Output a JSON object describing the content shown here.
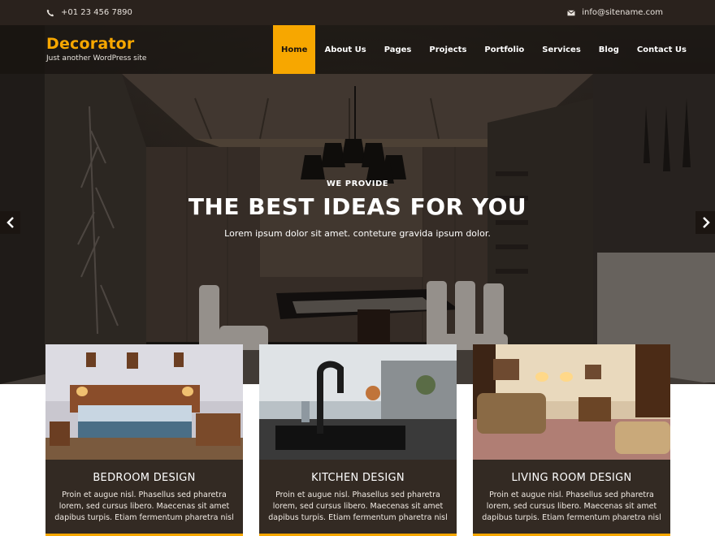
{
  "topbar": {
    "phone": "+01 23 456 7890",
    "email": "info@sitename.com",
    "phone_icon": "phone-icon",
    "email_icon": "envelope-icon"
  },
  "brand": {
    "title": "Decorator",
    "tagline": "Just another WordPress site"
  },
  "nav": {
    "items": [
      {
        "label": "Home",
        "active": true
      },
      {
        "label": "About Us"
      },
      {
        "label": "Pages"
      },
      {
        "label": "Projects"
      },
      {
        "label": "Portfolio"
      },
      {
        "label": "Services"
      },
      {
        "label": "Blog"
      },
      {
        "label": "Contact Us"
      }
    ]
  },
  "hero": {
    "kicker": "WE PROVIDE",
    "headline": "THE BEST IDEAS FOR YOU",
    "sub": "Lorem ipsum dolor sit amet. conteture gravida ipsum dolor.",
    "prev_icon": "chevron-left-icon",
    "next_icon": "chevron-right-icon"
  },
  "cards": [
    {
      "title": "BEDROOM DESIGN",
      "text": "Proin et augue nisl. Phasellus sed pharetra lorem, sed cursus libero. Maecenas sit amet dapibus turpis. Etiam fermentum pharetra nisl"
    },
    {
      "title": "KITCHEN DESIGN",
      "text": "Proin et augue nisl. Phasellus sed pharetra lorem, sed cursus libero. Maecenas sit amet dapibus turpis. Etiam fermentum pharetra nisl"
    },
    {
      "title": "LIVING ROOM DESIGN",
      "text": "Proin et augue nisl. Phasellus sed pharetra lorem, sed cursus libero. Maecenas sit amet dapibus turpis. Etiam fermentum pharetra nisl"
    }
  ],
  "colors": {
    "accent": "#f7a700",
    "topbar_bg": "#2a221d",
    "card_bg": "#332a23"
  }
}
